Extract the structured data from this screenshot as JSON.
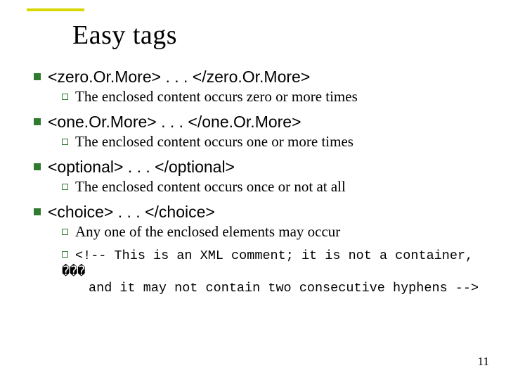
{
  "title": "Easy tags",
  "items": [
    {
      "tag": "<zero.Or.More> . . . </zero.Or.More>",
      "desc": "The enclosed content occurs zero or more times"
    },
    {
      "tag": "<one.Or.More> . . . </one.Or.More>",
      "desc": "The enclosed content occurs one or more times"
    },
    {
      "tag": "<optional> . . . </optional>",
      "desc": "The enclosed content occurs once or not at all"
    },
    {
      "tag": "<choice> . . . </choice>",
      "desc": "Any one of the enclosed elements may occur"
    }
  ],
  "comment_line1": "<!-- This is an XML comment; it is not a container, ���",
  "comment_line2": "and it may not contain two consecutive hyphens -->",
  "page_number": "11"
}
